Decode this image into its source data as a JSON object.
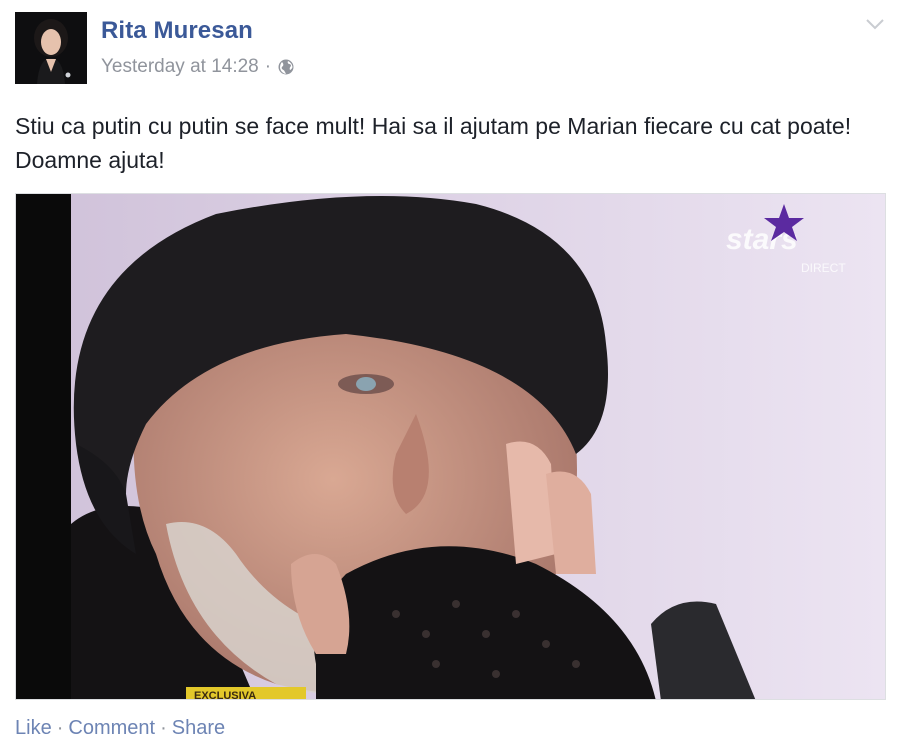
{
  "post": {
    "author": "Rita Muresan",
    "timestamp": "Yesterday at 14:28",
    "separator": "·",
    "privacy_icon": "globe-icon",
    "menu_icon": "chevron-down-icon",
    "text": "Stiu ca putin cu putin se face mult! Hai sa il ajutam pe Marian fiecare cu cat poate! Doamne ajuta!",
    "photo": {
      "description_icon": "photo",
      "watermark": "stars",
      "watermark_sub": "DIRECT",
      "banner": "EXCLUSIVA"
    }
  },
  "actions": {
    "like": "Like",
    "comment": "Comment",
    "share": "Share",
    "dot": "·"
  },
  "colors": {
    "link": "#3b5998",
    "meta": "#90949c",
    "text": "#1d2129"
  }
}
